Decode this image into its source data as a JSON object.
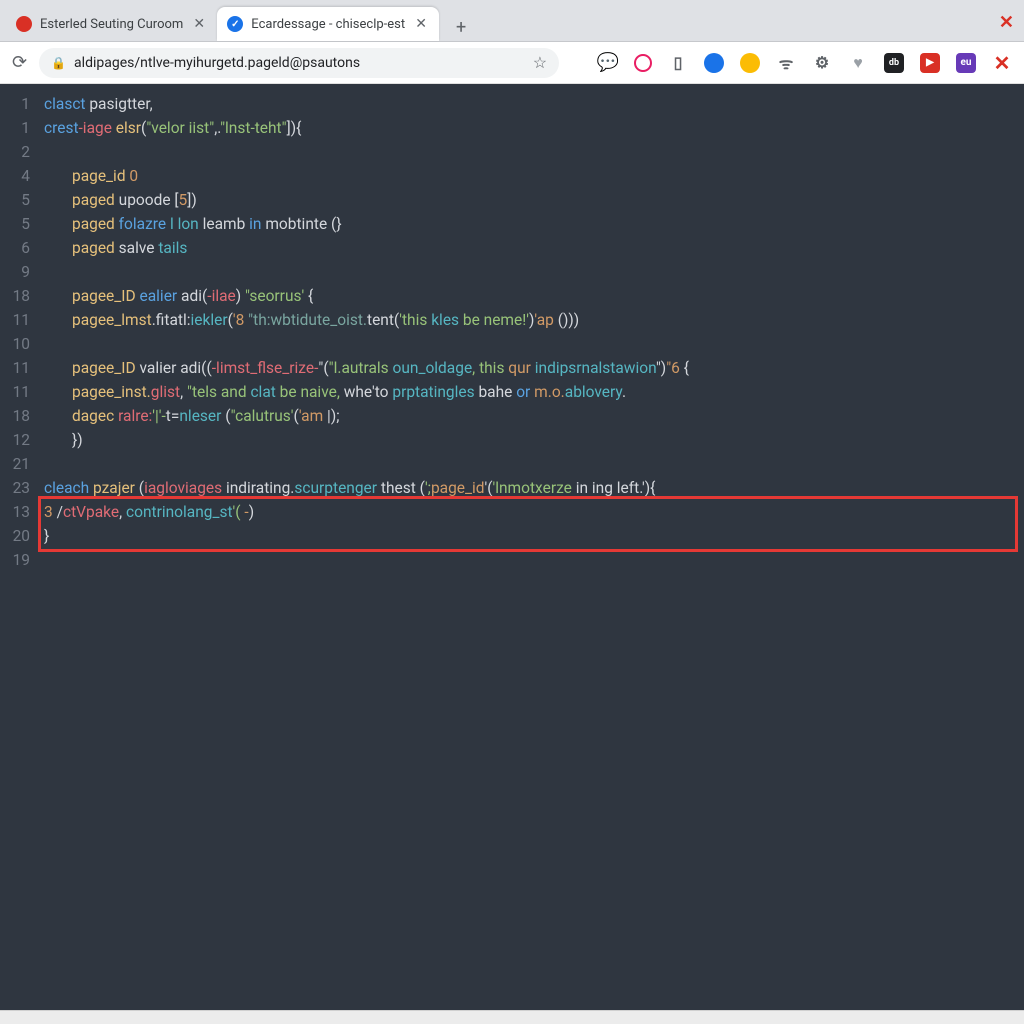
{
  "window": {
    "close_glyph": "✕"
  },
  "tabs": [
    {
      "title": "Esterled Seuting Curoom",
      "favicon": "red",
      "active": false
    },
    {
      "title": "Ecardessage - chiseclp-est",
      "favicon": "blue-check",
      "active": true
    }
  ],
  "newtab_glyph": "+",
  "addressbar": {
    "reload_glyph": "⟳",
    "lock_glyph": "🔒",
    "url": "aldipages/ntlve-myihurgetd.pageld@psautons",
    "star_glyph": "☆"
  },
  "ext_icons": [
    {
      "name": "chat-icon",
      "glyph": "💬",
      "cls": "e-chat"
    },
    {
      "name": "circle-icon",
      "glyph": "",
      "cls": "e-pink"
    },
    {
      "name": "bookmark-panel-icon",
      "glyph": "▯",
      "cls": "e-tab"
    },
    {
      "name": "blue-ext-icon",
      "glyph": "",
      "cls": "e-blue"
    },
    {
      "name": "yellow-ext-icon",
      "glyph": "",
      "cls": "e-yel"
    },
    {
      "name": "wifi-icon",
      "glyph": "ᯤ",
      "cls": "e-wifi"
    },
    {
      "name": "settings-icon",
      "glyph": "⚙",
      "cls": "e-gear"
    },
    {
      "name": "heart-icon",
      "glyph": "♥",
      "cls": "e-heart"
    },
    {
      "name": "dark-ext-icon",
      "glyph": "db",
      "cls": "e-dark"
    },
    {
      "name": "youtube-icon",
      "glyph": "▶",
      "cls": "e-yt"
    },
    {
      "name": "purple-ext-icon",
      "glyph": "eu",
      "cls": "e-purp"
    },
    {
      "name": "close-ext-icon",
      "glyph": "✕",
      "cls": "e-x"
    }
  ],
  "gutter": [
    "1",
    "1",
    "2",
    "4",
    "5",
    "5",
    "6",
    "9",
    "18",
    "11",
    "10",
    "11",
    "11",
    "18",
    "12",
    "21",
    "23",
    "13",
    "20",
    "19"
  ],
  "code": {
    "l0": {
      "a": "clasct",
      "b": " pasigtter",
      "c": ","
    },
    "l1": {
      "a": "crest",
      "b": "-iage ",
      "c": "elsr",
      "d": "(",
      "e": "\"velor iist\"",
      "f": ",.",
      "g": "\"lnst-teht\"",
      "h": "]){"
    },
    "l2": "",
    "l3": {
      "a": "page_id ",
      "b": "0"
    },
    "l4": {
      "a": "paged ",
      "b": "upoode ",
      "c": "[",
      "d": "5",
      "e": "])"
    },
    "l5": {
      "a": "paged ",
      "b": "folazre ",
      "c": "l lon ",
      "d": "leamb ",
      "e": "in ",
      "f": "mobtinte (}"
    },
    "l6": {
      "a": "paged ",
      "b": "salve ",
      "c": "tails"
    },
    "l7": "",
    "l8": {
      "a": "pagee_ID ",
      "b": "ealier ",
      "c": "adi(",
      "d": "-ilae",
      "e": ") ",
      "f": "\"seorrus'",
      "g": " {"
    },
    "l9": {
      "a": "pagee_lmst",
      "b": ".fitatl:",
      "c": "iekler",
      "d": "(",
      "e": "'8 ",
      "f": "\"th:wbtidute_oist.",
      "g": "tent(",
      "h": "'this ",
      "i": "kles ",
      "j": "be neme!'",
      "k": ")",
      "l": "'ap ",
      "m": "()))"
    },
    "l10": "",
    "l11": {
      "a": "pagee_ID ",
      "b": "valier ",
      "c": "adi((",
      "d": "-limst_flse_rize-",
      "e": "\"(",
      "f": "\"l.autrals ",
      "g": "oun_oldage",
      "h": ", this ",
      "i": "qur ",
      "j": "indipsrnalstawion",
      "k": "\")",
      "l": "\"6 ",
      "m": "{"
    },
    "l12": {
      "a": "pagee_inst.",
      "b": "glist",
      "c": ", ",
      "d": "\"tels and ",
      "e": "clat ",
      "f": "be naive, ",
      "g": "whe'to ",
      "h": "prptatingles ",
      "i": "bahe ",
      "j": "or ",
      "k": "m.o.",
      "l": "ablovery",
      "m": "."
    },
    "l13": {
      "a": "dagec ",
      "b": "ralre:",
      "c": "'|'-",
      "d": "t=",
      "e": "nleser ",
      "f": "(",
      "g": "\"calutrus'",
      "h": "(",
      "i": "'am ",
      "j": "|);"
    },
    "l14": {
      "a": "})"
    },
    "l15": "",
    "l16": {
      "a": "cleach ",
      "b": "pzajer ",
      "c": "(",
      "d": "iagloviages ",
      "e": "indirating.",
      "f": "scurptenger ",
      "g": "thest ",
      "h": "(",
      "i": "';",
      "j": "page_id",
      "k": "'(",
      "l": "'lnmotxerze ",
      "m": "in ing left.",
      "n": "'){"
    },
    "l17": {
      "a": "3",
      "b": " /",
      "c": "ctVpake",
      "d": ", ",
      "e": "contrinolang_st",
      "f": "'( ",
      "g": "-",
      "h": ")"
    },
    "l18": {
      "a": "}"
    }
  }
}
